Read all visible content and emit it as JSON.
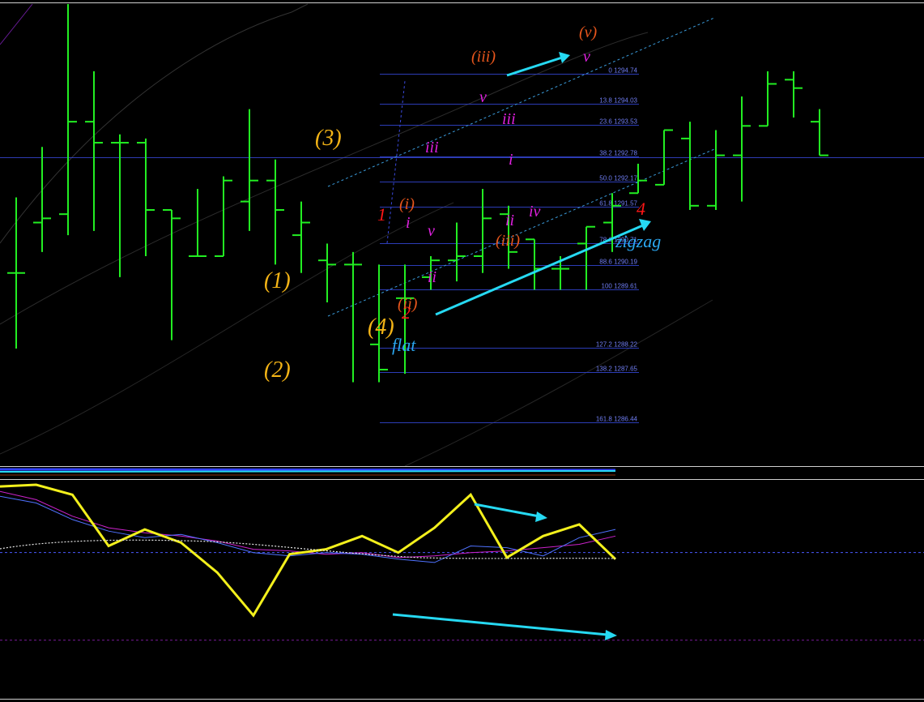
{
  "chart_data": [
    {
      "type": "ohlc",
      "price_range": [
        1285.5,
        1296.4
      ],
      "bars": [
        {
          "o": 1290.0,
          "h": 1291.8,
          "l": 1288.2,
          "c": 1290.0
        },
        {
          "o": 1291.2,
          "h": 1293.0,
          "l": 1290.5,
          "c": 1291.3
        },
        {
          "o": 1291.4,
          "h": 1296.4,
          "l": 1290.9,
          "c": 1293.6
        },
        {
          "o": 1293.6,
          "h": 1294.8,
          "l": 1291.0,
          "c": 1293.1
        },
        {
          "o": 1293.1,
          "h": 1293.3,
          "l": 1289.9,
          "c": 1293.1
        },
        {
          "o": 1293.1,
          "h": 1293.2,
          "l": 1290.4,
          "c": 1291.5
        },
        {
          "o": 1291.5,
          "h": 1291.5,
          "l": 1288.4,
          "c": 1291.3
        },
        {
          "o": 1290.4,
          "h": 1292.0,
          "l": 1290.4,
          "c": 1290.4
        },
        {
          "o": 1290.4,
          "h": 1292.3,
          "l": 1290.4,
          "c": 1292.2
        },
        {
          "o": 1291.7,
          "h": 1293.9,
          "l": 1291.0,
          "c": 1292.2
        },
        {
          "o": 1292.2,
          "h": 1292.7,
          "l": 1290.2,
          "c": 1291.5
        },
        {
          "o": 1290.9,
          "h": 1291.7,
          "l": 1290.0,
          "c": 1291.2
        },
        {
          "o": 1290.3,
          "h": 1290.7,
          "l": 1289.3,
          "c": 1290.2
        },
        {
          "o": 1290.2,
          "h": 1290.5,
          "l": 1287.4,
          "c": 1290.2
        },
        {
          "o": 1288.3,
          "h": 1290.2,
          "l": 1287.4,
          "c": 1287.7
        },
        {
          "o": 1289.4,
          "h": 1290.2,
          "l": 1287.6,
          "c": 1289.4
        },
        {
          "o": 1289.9,
          "h": 1290.4,
          "l": 1289.6,
          "c": 1290.3
        },
        {
          "o": 1290.3,
          "h": 1291.2,
          "l": 1289.8,
          "c": 1290.4
        },
        {
          "o": 1290.4,
          "h": 1292.0,
          "l": 1290.0,
          "c": 1291.3
        },
        {
          "o": 1291.4,
          "h": 1291.6,
          "l": 1290.1,
          "c": 1290.5
        },
        {
          "o": 1290.8,
          "h": 1290.8,
          "l": 1289.6,
          "c": 1290.1
        },
        {
          "o": 1290.1,
          "h": 1290.4,
          "l": 1289.6,
          "c": 1290.1
        },
        {
          "o": 1290.7,
          "h": 1291.1,
          "l": 1289.6,
          "c": 1291.1
        },
        {
          "o": 1291.2,
          "h": 1291.9,
          "l": 1290.5,
          "c": 1291.6
        },
        {
          "o": 1291.9,
          "h": 1292.6,
          "l": 1291.9,
          "c": 1292.2
        },
        {
          "o": 1292.1,
          "h": 1293.4,
          "l": 1292.1,
          "c": 1293.4
        },
        {
          "o": 1293.2,
          "h": 1293.6,
          "l": 1291.5,
          "c": 1291.6
        },
        {
          "o": 1291.6,
          "h": 1293.4,
          "l": 1291.5,
          "c": 1292.8
        },
        {
          "o": 1292.8,
          "h": 1294.2,
          "l": 1291.7,
          "c": 1293.5
        },
        {
          "o": 1293.5,
          "h": 1294.8,
          "l": 1293.5,
          "c": 1294.5
        },
        {
          "o": 1294.6,
          "h": 1294.8,
          "l": 1293.7,
          "c": 1294.4
        },
        {
          "o": 1293.6,
          "h": 1293.9,
          "l": 1292.8,
          "c": 1292.8
        }
      ]
    },
    {
      "type": "line",
      "ylim": [
        0,
        100
      ],
      "series": [
        {
          "color": "#f3f01c",
          "values": [
            98,
            99,
            93,
            62,
            72,
            64,
            46,
            20,
            57,
            60,
            68,
            58,
            73,
            93,
            55,
            68,
            75,
            54
          ]
        },
        {
          "color": "#4f72ff",
          "values": [
            92,
            88,
            78,
            71,
            67,
            69,
            64,
            58,
            56,
            58,
            57,
            54,
            52,
            62,
            61,
            56,
            67,
            72
          ]
        },
        {
          "color": "#cc22cc",
          "values": [
            95,
            90,
            80,
            73,
            70,
            68,
            65,
            60,
            59,
            57,
            58,
            55,
            56,
            58,
            59,
            61,
            63,
            68
          ]
        }
      ],
      "hlines": [
        {
          "value": 58,
          "color": "#4a5aff"
        },
        {
          "value": 5,
          "color": "#7a1a9a"
        }
      ]
    }
  ],
  "fib_levels": [
    {
      "ratio": "0",
      "price": "1294.74"
    },
    {
      "ratio": "13.8",
      "price": "1294.03"
    },
    {
      "ratio": "23.6",
      "price": "1293.53"
    },
    {
      "ratio": "38.2",
      "price": "1292.78"
    },
    {
      "ratio": "50.0",
      "price": "1292.17"
    },
    {
      "ratio": "61.8",
      "price": "1291.57"
    },
    {
      "ratio": "78.6",
      "price": "1290.71"
    },
    {
      "ratio": "88.6",
      "price": "1290.19"
    },
    {
      "ratio": "100",
      "price": "1289.61"
    },
    {
      "ratio": "127.2",
      "price": "1288.22"
    },
    {
      "ratio": "138.2",
      "price": "1287.65"
    },
    {
      "ratio": "161.8",
      "price": "1286.44"
    }
  ],
  "labels": {
    "wave_3": "(3)",
    "wave_1": "(1)",
    "wave_2": "(2)",
    "wave_4": "(4)",
    "flat": "flat",
    "zigzag": "zigzag",
    "red_1": "1",
    "red_2": "2",
    "red_4": "4",
    "o_i": "(i)",
    "o_ii": "(ii)",
    "o_iii_top": "(iii)",
    "o_iii_low": "(iii)",
    "o_v": "(v)",
    "m_i_low": "i",
    "m_v_low": "v",
    "m_ii_low": "ii",
    "m_iii_a": "iii",
    "m_v_a": "v",
    "m_iii_b": "iii",
    "m_i_b": "i",
    "m_ii_b": "ii",
    "m_iv_b": "iv",
    "m_v_top": "v"
  },
  "colors": {
    "bars": "#22ee22",
    "gold": "#f4b416",
    "red": "#ff1616",
    "orange": "#e8561c",
    "magenta": "#e020e0",
    "cyan": "#26d9f2",
    "flat_text": "#2aa6ef",
    "fib_line": "#2a3aa5"
  }
}
